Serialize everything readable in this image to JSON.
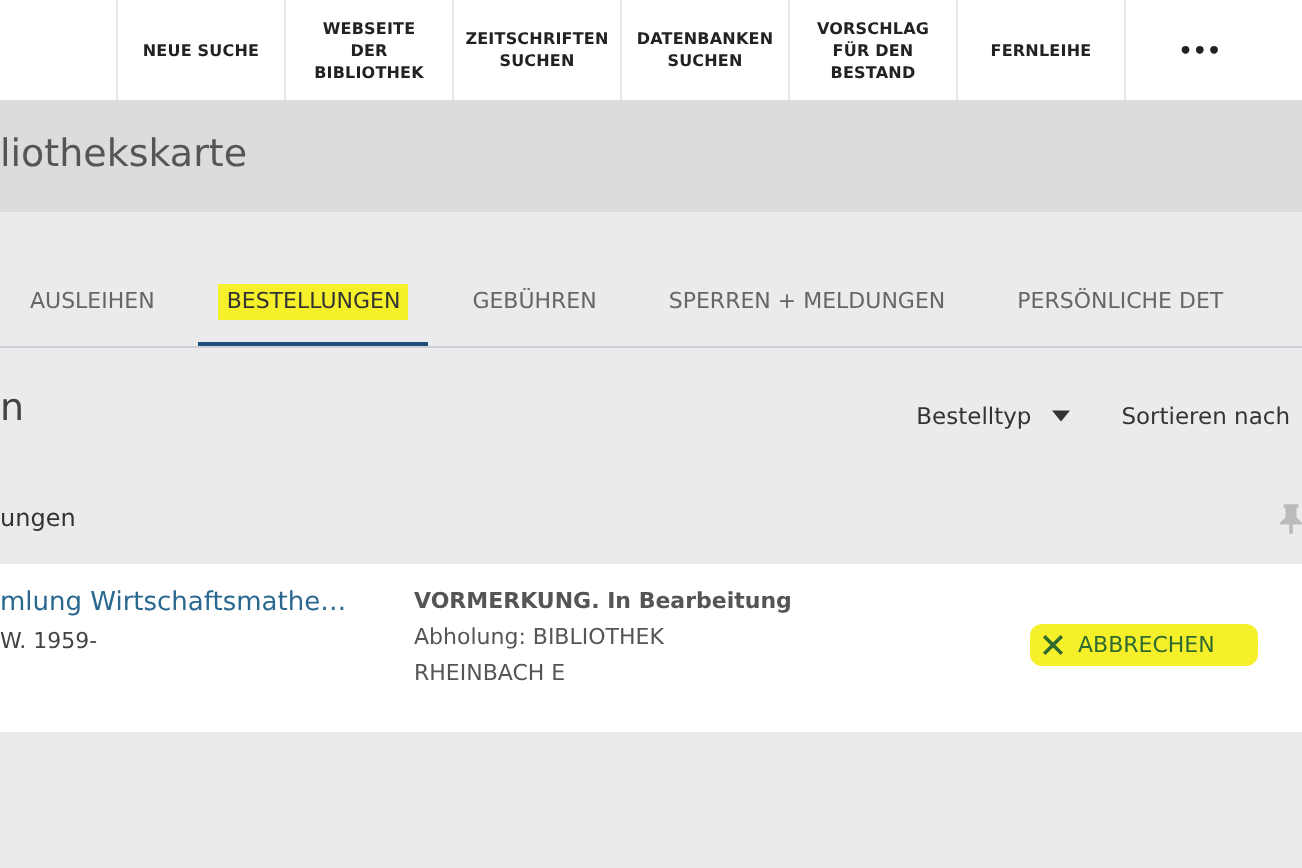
{
  "nav": [
    {
      "label": "NEUE SUCHE"
    },
    {
      "label": "WEBSEITE\nDER\nBIBLIOTHEK"
    },
    {
      "label": "ZEITSCHRIFTEN\nSUCHEN"
    },
    {
      "label": "DATENBANKEN\nSUCHEN"
    },
    {
      "label": "VORSCHLAG\nFÜR DEN\nBESTAND"
    },
    {
      "label": "FERNLEIHE"
    },
    {
      "label": "•••"
    }
  ],
  "page_title": "liothekskarte",
  "tabs": [
    {
      "label": "AUSLEIHEN",
      "selected": false,
      "highlighted": false
    },
    {
      "label": "BESTELLUNGEN",
      "selected": true,
      "highlighted": true
    },
    {
      "label": "GEBÜHREN",
      "selected": false,
      "highlighted": false
    },
    {
      "label": "SPERREN + MELDUNGEN",
      "selected": false,
      "highlighted": false
    },
    {
      "label": "PERSÖNLICHE DET",
      "selected": false,
      "highlighted": false
    }
  ],
  "section_heading": "n",
  "filters": [
    {
      "label": "Bestelltyp"
    },
    {
      "label": "Sortieren nach"
    }
  ],
  "list_heading": "ungen",
  "requests": [
    {
      "title": "mlung Wirtschaftsmathe…",
      "subtitle": "W. 1959-",
      "status": "VORMERKUNG. In Bearbeitung",
      "pickup": [
        "Abholung: BIBLIOTHEK",
        "RHEINBACH E"
      ],
      "action": {
        "label": "ABBRECHEN",
        "highlighted": true
      }
    }
  ]
}
